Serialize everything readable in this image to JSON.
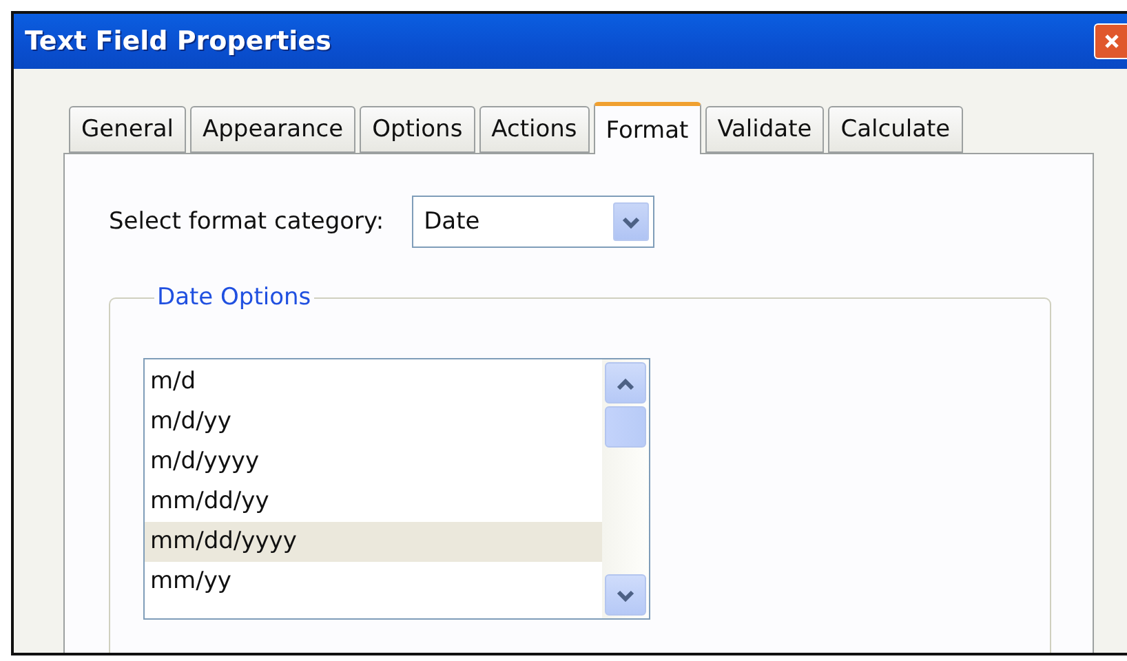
{
  "window": {
    "title": "Text Field Properties"
  },
  "tabs": [
    {
      "label": "General",
      "selected": false
    },
    {
      "label": "Appearance",
      "selected": false
    },
    {
      "label": "Options",
      "selected": false
    },
    {
      "label": "Actions",
      "selected": false
    },
    {
      "label": "Format",
      "selected": true
    },
    {
      "label": "Validate",
      "selected": false
    },
    {
      "label": "Calculate",
      "selected": false
    }
  ],
  "format_category": {
    "label": "Select format category:",
    "value": "Date"
  },
  "date_options": {
    "legend": "Date Options",
    "items": [
      {
        "label": "m/d",
        "selected": false
      },
      {
        "label": "m/d/yy",
        "selected": false
      },
      {
        "label": "m/d/yyyy",
        "selected": false
      },
      {
        "label": "mm/dd/yy",
        "selected": false
      },
      {
        "label": "mm/dd/yyyy",
        "selected": true
      },
      {
        "label": "mm/yy",
        "selected": false
      }
    ]
  }
}
